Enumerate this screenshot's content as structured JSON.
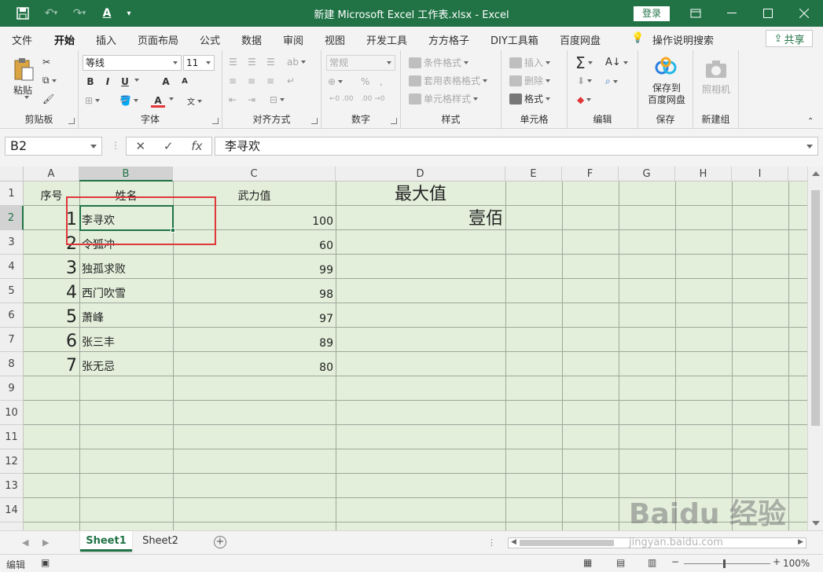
{
  "window": {
    "title": "新建 Microsoft Excel 工作表.xlsx  -  Excel",
    "login_label": "登录",
    "share_label": "共享",
    "accent_color": "#217346",
    "selection_box_color": "#e0373a"
  },
  "menu": {
    "tabs": [
      {
        "label": "文件"
      },
      {
        "label": "开始"
      },
      {
        "label": "插入"
      },
      {
        "label": "页面布局"
      },
      {
        "label": "公式"
      },
      {
        "label": "数据"
      },
      {
        "label": "审阅"
      },
      {
        "label": "视图"
      },
      {
        "label": "开发工具"
      },
      {
        "label": "方方格子"
      },
      {
        "label": "DIY工具箱"
      },
      {
        "label": "百度网盘"
      }
    ],
    "active_tab": "开始",
    "tell_me": "操作说明搜索"
  },
  "ribbon": {
    "clipboard": {
      "label": "剪贴板",
      "paste": "粘贴"
    },
    "font": {
      "label": "字体",
      "font_name": "等线",
      "font_size": "11",
      "bold": "B",
      "italic": "I",
      "underline": "U",
      "grow": "A",
      "shrink": "A",
      "color": "A"
    },
    "align": {
      "label": "对齐方式"
    },
    "number": {
      "label": "数字",
      "format": "常规",
      "percent": "%"
    },
    "styles": {
      "label": "样式",
      "conditional": "条件格式",
      "table": "套用表格格式",
      "cell": "单元格样式"
    },
    "cells": {
      "label": "单元格",
      "insert": "插入",
      "delete": "删除",
      "format": "格式"
    },
    "editing": {
      "label": "编辑"
    },
    "save": {
      "label": "保存",
      "button": "保存到\n百度网盘"
    },
    "newgroup": {
      "label": "新建组",
      "camera": "照相机"
    }
  },
  "formula_bar": {
    "name_box": "B2",
    "cancel": "✕",
    "confirm": "✓",
    "fx": "fx",
    "value": "李寻欢"
  },
  "grid": {
    "columns": [
      "A",
      "B",
      "C",
      "D",
      "E",
      "F",
      "G",
      "H",
      "I"
    ],
    "rows": [
      "1",
      "2",
      "3",
      "4",
      "5",
      "6",
      "7",
      "8",
      "9",
      "10",
      "11",
      "12",
      "13",
      "14"
    ],
    "selected_column": "B",
    "selected_row": "2",
    "cells": {
      "A1": "序号",
      "B1": "姓名",
      "C1": "武力值",
      "D1": "最大值",
      "A2": "1",
      "B2": "李寻欢",
      "C2": "100",
      "D2": "壹佰",
      "A3": "2",
      "B3": "令狐冲",
      "C3": "60",
      "A4": "3",
      "B4": "独孤求败",
      "C4": "99",
      "A5": "4",
      "B5": "西门吹雪",
      "C5": "98",
      "A6": "5",
      "B6": "萧峰",
      "C6": "97",
      "A7": "6",
      "B7": "张三丰",
      "C7": "89",
      "A8": "7",
      "B8": "张无忌",
      "C8": "80"
    },
    "background": "#e3efdb"
  },
  "sheets": {
    "tabs": [
      {
        "label": "Sheet1"
      },
      {
        "label": "Sheet2"
      }
    ],
    "active": "Sheet1"
  },
  "status": {
    "mode": "编辑",
    "zoom": "100%"
  },
  "watermark": {
    "text": "Baidu 经验",
    "url": "jingyan.baidu.com"
  }
}
